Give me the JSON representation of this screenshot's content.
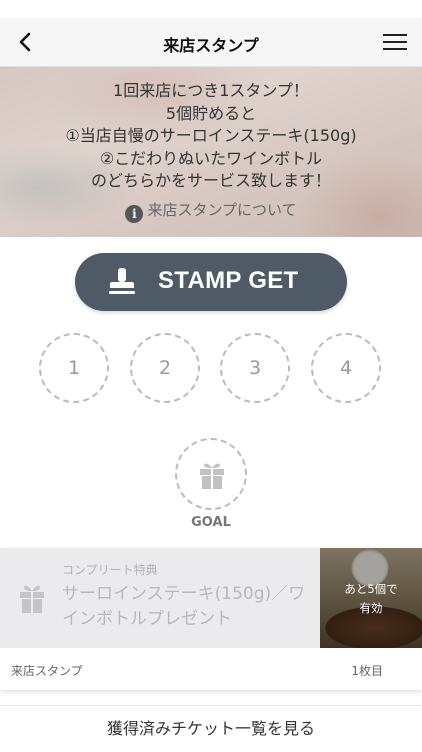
{
  "nav": {
    "title": "来店スタンプ"
  },
  "hero": {
    "lines": [
      "1回来店につき1スタンプ！",
      "5個貯めると",
      "①当店自慢のサーロインステーキ(150g)",
      "②こだわりぬいたワインボトル",
      "のどちらかをサービス致します！"
    ],
    "info_link": "来店スタンプについて"
  },
  "stamp_button": {
    "label": "STAMP GET"
  },
  "stamps": {
    "slots": [
      "1",
      "2",
      "3",
      "4"
    ],
    "goal_label": "GOAL"
  },
  "reward_card": {
    "subtitle": "コンプリート特典",
    "title": "サーロインステーキ(150g)／ワインボトルプレゼント",
    "photo_line1": "あと5個で",
    "photo_line2": "有効",
    "footer_label": "来店スタンプ",
    "footer_count": "1枚目"
  },
  "ticket_link": {
    "label": "獲得済みチケット一覧を見る"
  },
  "colors": {
    "button": "#4e5a66",
    "dashed": "#bbbbbb",
    "card_bg": "#ebebee"
  }
}
